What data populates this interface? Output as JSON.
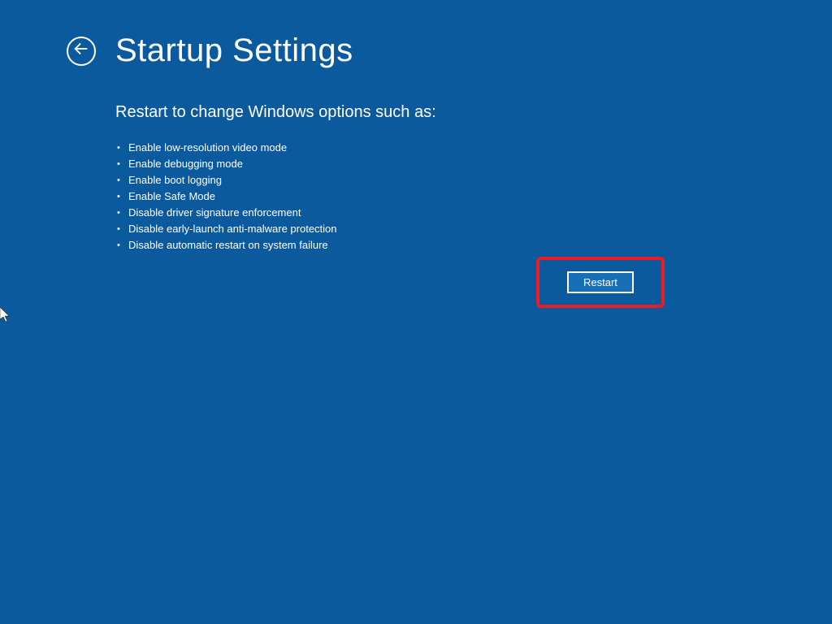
{
  "header": {
    "title": "Startup Settings"
  },
  "content": {
    "subtitle": "Restart to change Windows options such as:",
    "options": [
      "Enable low-resolution video mode",
      "Enable debugging mode",
      "Enable boot logging",
      "Enable Safe Mode",
      "Disable driver signature enforcement",
      "Disable early-launch anti-malware protection",
      "Disable automatic restart on system failure"
    ]
  },
  "buttons": {
    "restart": "Restart"
  }
}
